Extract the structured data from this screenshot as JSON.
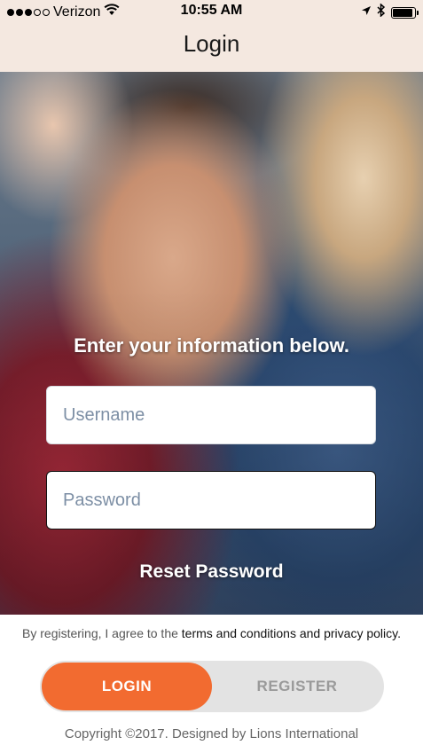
{
  "status_bar": {
    "carrier": "Verizon",
    "time": "10:55 AM"
  },
  "nav": {
    "title": "Login"
  },
  "form": {
    "heading": "Enter your information below.",
    "username": {
      "placeholder": "Username",
      "value": ""
    },
    "password": {
      "placeholder": "Password",
      "value": ""
    },
    "reset_label": "Reset Password"
  },
  "terms": {
    "prefix": "By registering, I agree to the ",
    "link": "terms and conditions and privacy policy."
  },
  "toggle": {
    "login_label": "LOGIN",
    "register_label": "REGISTER",
    "selected": "LOGIN"
  },
  "footer": {
    "copyright": "Copyright ©2017. Designed by Lions International"
  },
  "colors": {
    "accent": "#f26b30",
    "nav_background": "#f4e8e0",
    "toggle_background": "#e3e3e3",
    "placeholder": "#7d8fa5"
  },
  "icons": [
    "signal-dots-icon",
    "wifi-icon",
    "location-arrow-icon",
    "bluetooth-icon",
    "battery-icon"
  ]
}
